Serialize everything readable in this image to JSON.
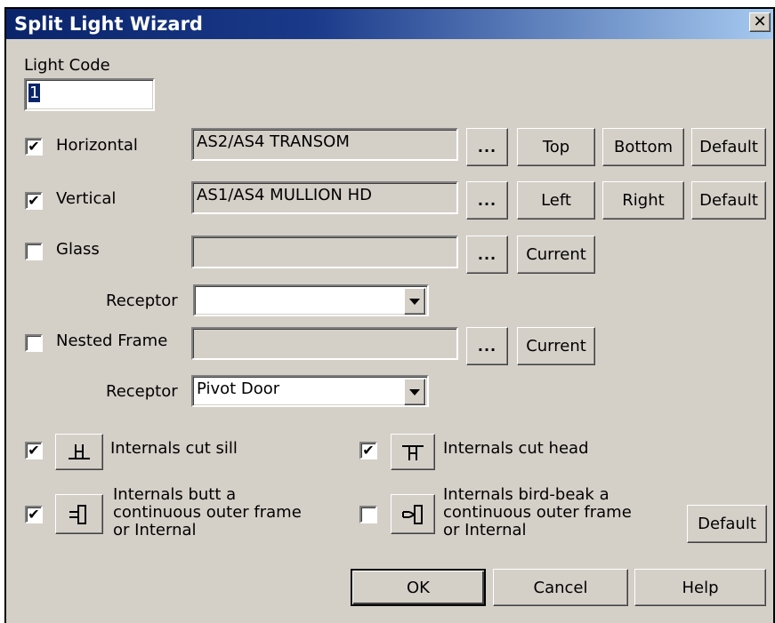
{
  "window": {
    "title": "Split Light Wizard",
    "close_glyph": "✕"
  },
  "light_code": {
    "label": "Light Code",
    "value": "1"
  },
  "rows": {
    "horizontal": {
      "checked": true,
      "label": "Horizontal",
      "value": "AS2/AS4 TRANSOM",
      "browse": "...",
      "btn1": "Top",
      "btn2": "Bottom",
      "btn3": "Default"
    },
    "vertical": {
      "checked": true,
      "label": "Vertical",
      "value": "AS1/AS4 MULLION HD",
      "browse": "...",
      "btn1": "Left",
      "btn2": "Right",
      "btn3": "Default"
    },
    "glass": {
      "checked": false,
      "label": "Glass",
      "value": "",
      "browse": "...",
      "current": "Current",
      "receptor_label": "Receptor",
      "receptor_value": ""
    },
    "nested": {
      "checked": false,
      "label": "Nested Frame",
      "value": "",
      "browse": "...",
      "current": "Current",
      "receptor_label": "Receptor",
      "receptor_value": "Pivot Door"
    }
  },
  "options": {
    "cut_sill": {
      "checked": true,
      "icon": "cut-sill-icon",
      "label": "Internals cut sill"
    },
    "cut_head": {
      "checked": true,
      "icon": "cut-head-icon",
      "label": "Internals cut head"
    },
    "butt": {
      "checked": true,
      "icon": "butt-icon",
      "line1": "Internals butt a",
      "line2": "continuous outer frame",
      "line3": "or Internal"
    },
    "bird_beak": {
      "checked": false,
      "icon": "bird-beak-icon",
      "line1": "Internals bird-beak a",
      "line2": "continuous outer frame",
      "line3": "or Internal"
    },
    "default_label": "Default"
  },
  "footer": {
    "ok": "OK",
    "cancel": "Cancel",
    "help": "Help"
  },
  "check_glyph": "✔"
}
